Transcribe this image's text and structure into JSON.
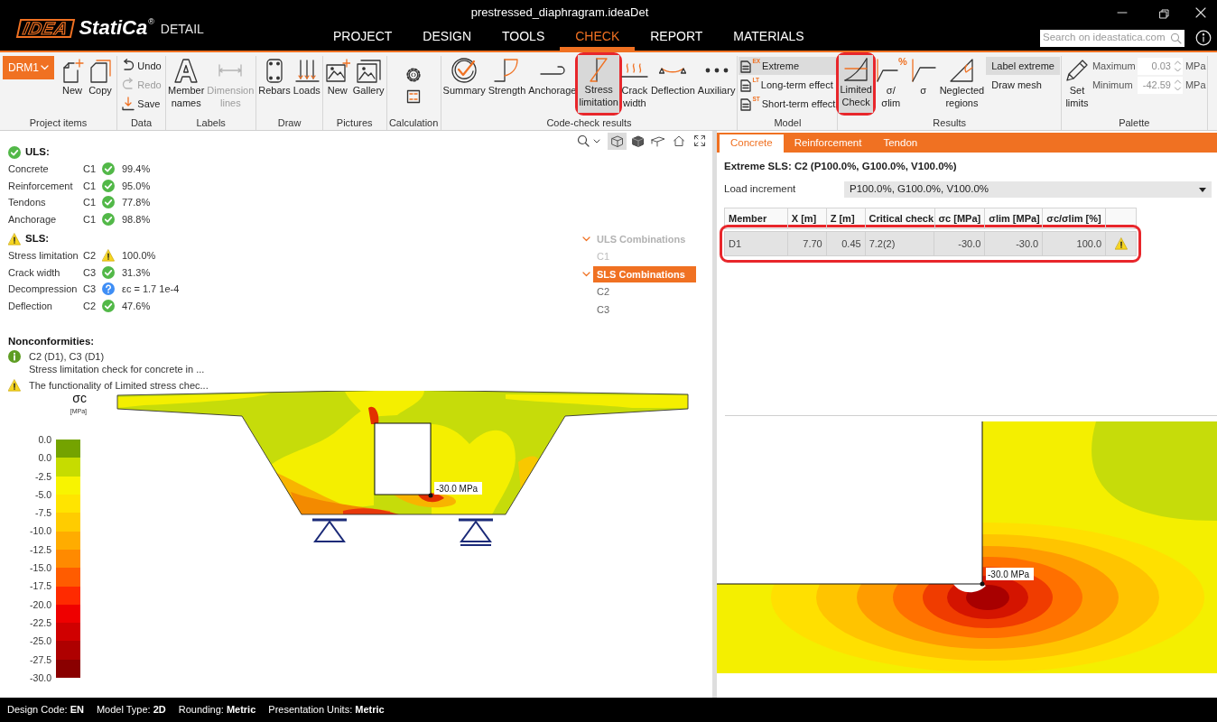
{
  "window": {
    "title": "prestressed_diaphragram.ideaDet"
  },
  "logo": {
    "mark": "IDEA",
    "name": "StatiCa",
    "registered": "®",
    "product": "DETAIL"
  },
  "menu": [
    {
      "label": "PROJECT",
      "selected": false
    },
    {
      "label": "DESIGN",
      "selected": false
    },
    {
      "label": "TOOLS",
      "selected": false
    },
    {
      "label": "CHECK",
      "selected": true
    },
    {
      "label": "REPORT",
      "selected": false
    },
    {
      "label": "MATERIALS",
      "selected": false
    }
  ],
  "search": {
    "placeholder": "Search on ideastatica.com"
  },
  "ribbon": {
    "groups": [
      {
        "label": "Project items",
        "items": [
          {
            "kind": "dropdown",
            "label": "DRM1"
          },
          {
            "kind": "large",
            "label": "New"
          },
          {
            "kind": "large",
            "label": "Copy"
          }
        ]
      },
      {
        "label": "Data",
        "items": [
          {
            "kind": "small",
            "label": "Undo",
            "disabled": false
          },
          {
            "kind": "small",
            "label": "Redo",
            "disabled": true
          },
          {
            "kind": "small",
            "label": "Save",
            "disabled": false
          }
        ]
      },
      {
        "label": "Labels",
        "items": [
          {
            "kind": "large",
            "label": "Member names",
            "disabled": false
          },
          {
            "kind": "large",
            "label": "Dimension lines",
            "disabled": true
          }
        ]
      },
      {
        "label": "Draw",
        "items": [
          {
            "kind": "large",
            "label": "Rebars"
          },
          {
            "kind": "large",
            "label": "Loads"
          }
        ]
      },
      {
        "label": "Pictures",
        "items": [
          {
            "kind": "large",
            "label": "New"
          },
          {
            "kind": "large",
            "label": "Gallery"
          }
        ]
      },
      {
        "label": "Calculation",
        "items": [
          {
            "kind": "icon"
          },
          {
            "kind": "icon"
          }
        ]
      },
      {
        "label": "Code-check results",
        "items": [
          {
            "kind": "large",
            "label": "Summary",
            "selected": false
          },
          {
            "kind": "large",
            "label": "Strength",
            "selected": false
          },
          {
            "kind": "large",
            "label": "Anchorage",
            "selected": false
          },
          {
            "kind": "large",
            "label": "Stress limitation",
            "selected": true,
            "highlighted": true
          },
          {
            "kind": "large",
            "label": "Crack width",
            "selected": false
          },
          {
            "kind": "large",
            "label": "Deflection",
            "selected": false
          },
          {
            "kind": "large",
            "label": "Auxiliary",
            "selected": false
          }
        ]
      },
      {
        "label": "Model",
        "items": [
          {
            "kind": "small",
            "label": "Extreme",
            "tag": "EX",
            "selected": true
          },
          {
            "kind": "small",
            "label": "Long-term effect",
            "tag": "LT",
            "selected": false
          },
          {
            "kind": "small",
            "label": "Short-term effect",
            "tag": "ST",
            "selected": false
          }
        ]
      },
      {
        "label": "Results",
        "items": [
          {
            "kind": "large",
            "label": "Limited Check",
            "selected": true,
            "highlighted": true
          },
          {
            "kind": "large",
            "label": "σ/σlim",
            "tag": "%",
            "selected": false
          },
          {
            "kind": "large",
            "label": "σ",
            "selected": false
          },
          {
            "kind": "large",
            "label": "Neglected regions",
            "selected": false
          },
          {
            "kind": "small",
            "label": "Label extreme",
            "selected": true
          },
          {
            "kind": "small",
            "label": "Draw mesh",
            "selected": false
          }
        ]
      },
      {
        "label": "Palette",
        "items": [
          {
            "kind": "large",
            "label": "Set limits",
            "disabled": false
          },
          {
            "kind": "spinner",
            "label": "Maximum",
            "value": "0.03",
            "unit": "MPa",
            "disabled": true
          },
          {
            "kind": "spinner",
            "label": "Minimum",
            "value": "-42.59",
            "unit": "MPa",
            "disabled": true
          }
        ]
      }
    ]
  },
  "view_toolbar": {
    "views": [
      {
        "selected": true
      },
      {
        "selected": false
      },
      {
        "selected": false
      }
    ]
  },
  "summary": [
    {
      "title": "ULS:",
      "kind": "ok",
      "rows": [
        {
          "name": "Concrete",
          "combination": "C1",
          "kind": "ok",
          "value": "99.4%"
        },
        {
          "name": "Reinforcement",
          "combination": "C1",
          "kind": "ok",
          "value": "95.0%"
        },
        {
          "name": "Tendons",
          "combination": "C1",
          "kind": "ok",
          "value": "77.8%"
        },
        {
          "name": "Anchorage",
          "combination": "C1",
          "kind": "ok",
          "value": "98.8%"
        }
      ]
    },
    {
      "title": "SLS:",
      "kind": "warning",
      "rows": [
        {
          "name": "Stress limitation",
          "combination": "C2",
          "kind": "warning",
          "value": "100.0%"
        },
        {
          "name": "Crack width",
          "combination": "C3",
          "kind": "ok",
          "value": "31.3%"
        },
        {
          "name": "Decompression",
          "combination": "C3",
          "kind": "unknown",
          "value": "εc = 1.7 1e-4"
        },
        {
          "name": "Deflection",
          "combination": "C2",
          "kind": "ok",
          "value": "47.6%"
        }
      ]
    }
  ],
  "nonconformities": {
    "title": "Nonconformities:",
    "items": [
      {
        "kind": "info",
        "title": "C2 (D1), C3 (D1)",
        "text": "Stress limitation check for concrete in ..."
      },
      {
        "kind": "warning",
        "title": "The functionality of Limited stress chec..."
      }
    ]
  },
  "combinations": [
    {
      "label": "ULS Combinations",
      "expanded": true,
      "selected": false,
      "disabled": true,
      "children": [
        {
          "label": "C1",
          "selected": false,
          "disabled": true
        }
      ]
    },
    {
      "label": "SLS Combinations",
      "expanded": true,
      "selected": true,
      "disabled": false,
      "children": [
        {
          "label": "C2",
          "selected": false,
          "disabled": false
        },
        {
          "label": "C3",
          "selected": false,
          "disabled": false
        }
      ]
    }
  ],
  "legend": {
    "symbol": "σc",
    "unit": "[MPa]",
    "ticks": [
      "0.0",
      "0.0",
      "-2.5",
      "-5.0",
      "-7.5",
      "-10.0",
      "-12.5",
      "-15.0",
      "-17.5",
      "-20.0",
      "-22.5",
      "-25.0",
      "-27.5",
      "-30.0"
    ],
    "bands": [
      {
        "color": "#74a300"
      },
      {
        "color": "#c6dc00"
      },
      {
        "color": "#f8f400"
      },
      {
        "color": "#ffe400"
      },
      {
        "color": "#ffcc00"
      },
      {
        "color": "#ffac00"
      },
      {
        "color": "#ff8a00"
      },
      {
        "color": "#ff5c00"
      },
      {
        "color": "#ff2a00"
      },
      {
        "color": "#ef0000"
      },
      {
        "color": "#d00000"
      },
      {
        "color": "#ae0000"
      },
      {
        "color": "#8a0000"
      }
    ]
  },
  "diagram": {
    "extreme_label": "-30.0 MPa"
  },
  "detail": {
    "tabs": [
      {
        "label": "Concrete",
        "selected": true
      },
      {
        "label": "Reinforcement",
        "selected": false
      },
      {
        "label": "Tendon",
        "selected": false
      }
    ],
    "heading": "Extreme SLS: C2 (P100.0%, G100.0%, V100.0%)",
    "load_increment": {
      "label": "Load increment",
      "value": "P100.0%, G100.0%, V100.0%"
    },
    "table": {
      "columns": [
        "Member",
        "X [m]",
        "Z [m]",
        "Critical check",
        "σc [MPa]",
        "σlim [MPa]",
        "σc/σlim [%]"
      ],
      "rows": [
        {
          "cells": [
            "D1",
            "7.70",
            "0.45",
            "7.2(2)",
            "-30.0",
            "-30.0",
            "100.0"
          ],
          "kind": "warning",
          "selected": true,
          "highlighted": true
        }
      ]
    },
    "zoom_view": {
      "extreme_label": "-30.0 MPa"
    }
  },
  "status_bar": [
    {
      "label": "Design Code:",
      "value": "EN"
    },
    {
      "label": "Model Type:",
      "value": "2D"
    },
    {
      "label": "Rounding:",
      "value": "Metric"
    },
    {
      "label": "Presentation Units:",
      "value": "Metric"
    }
  ]
}
